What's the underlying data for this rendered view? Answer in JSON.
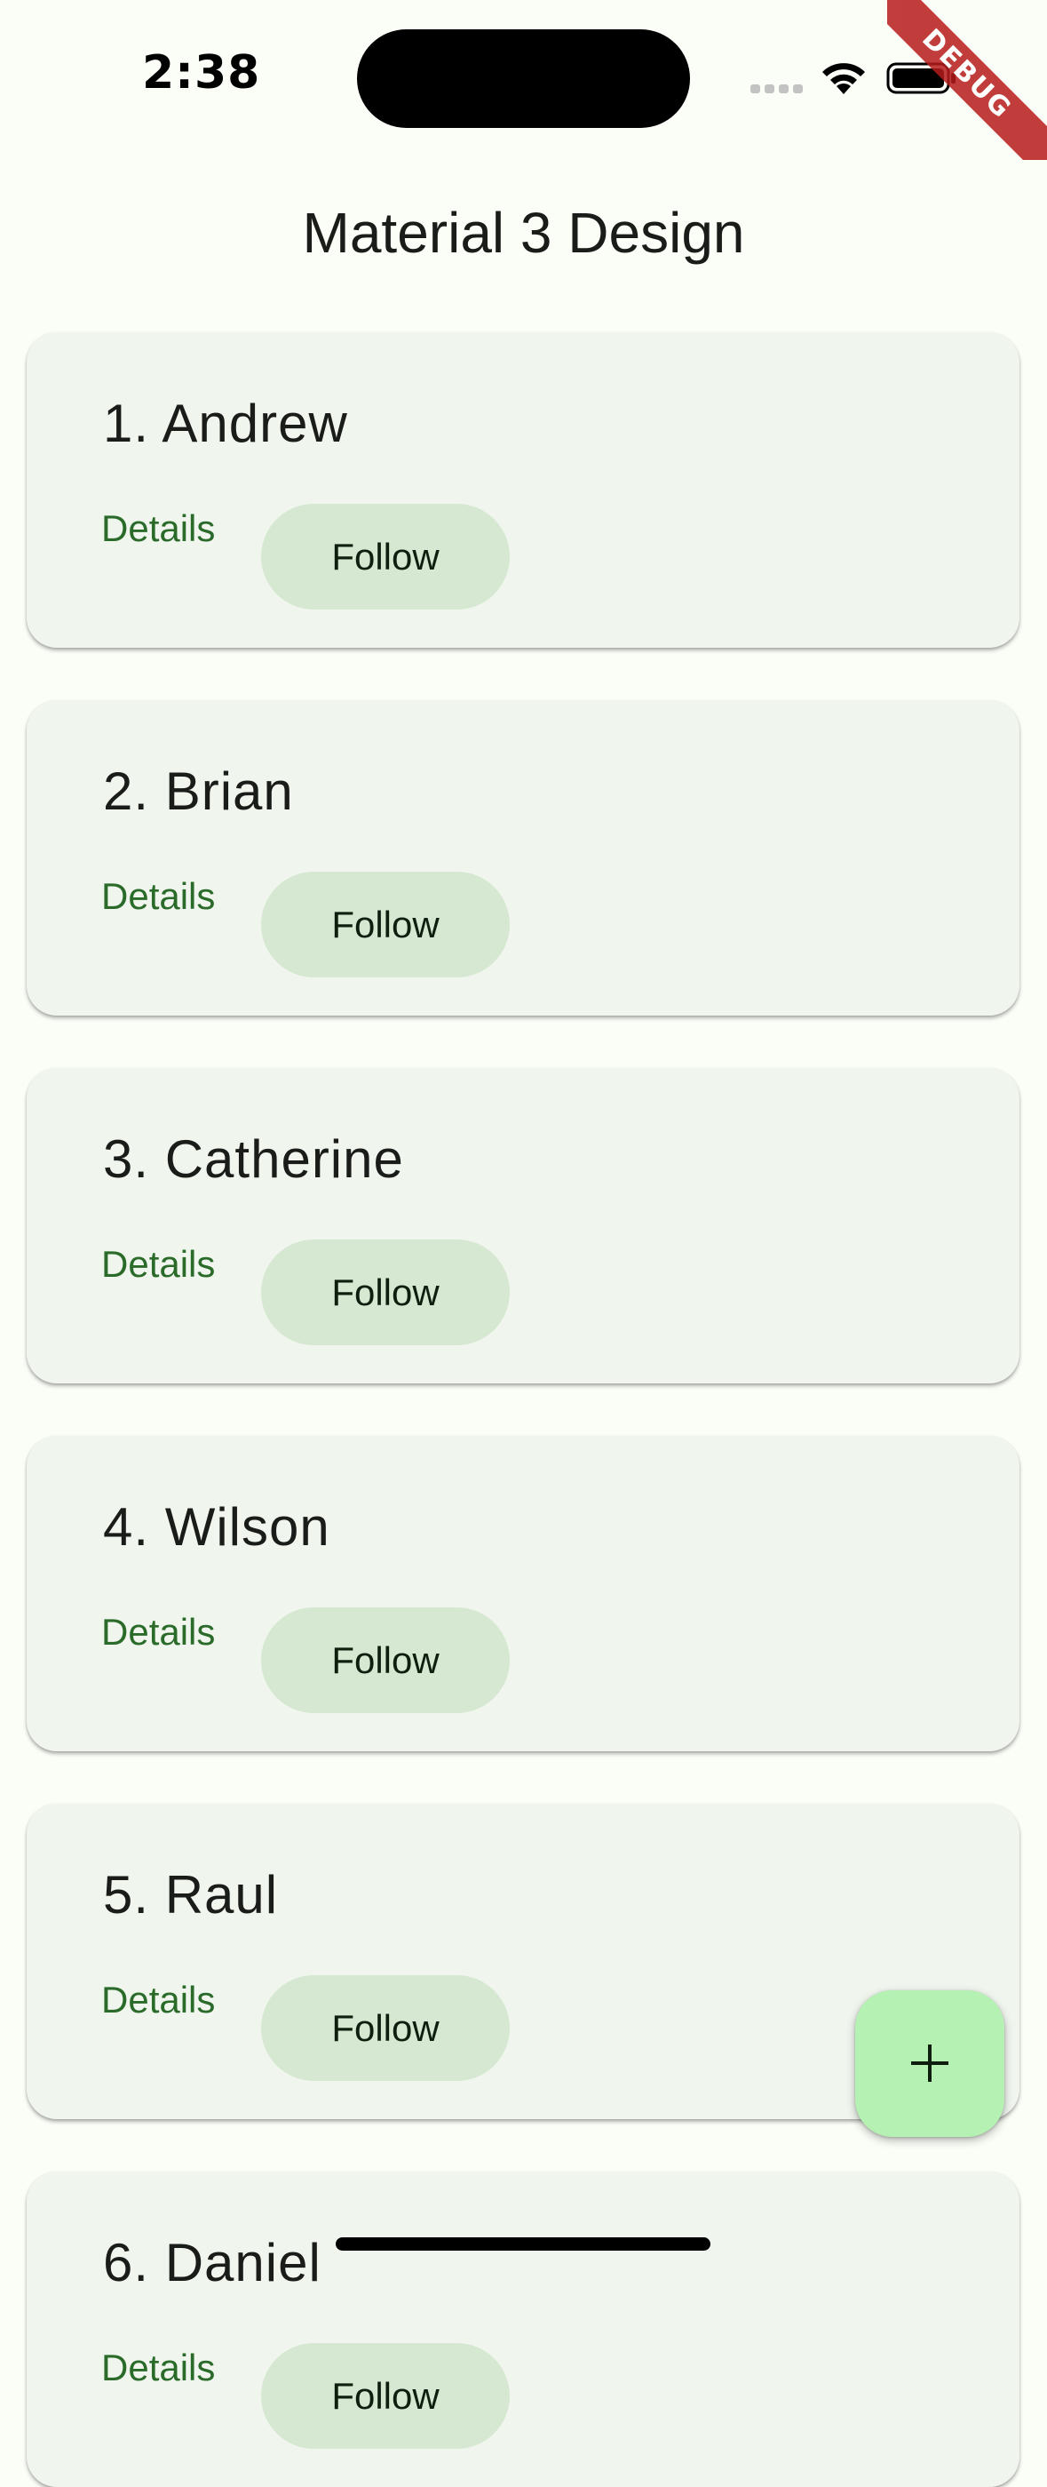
{
  "status_bar": {
    "time": "2:38"
  },
  "debug_banner": "DEBUG",
  "app_bar": {
    "title": "Material 3 Design"
  },
  "cards": [
    {
      "title": "1. Andrew",
      "details_label": "Details",
      "follow_label": "Follow"
    },
    {
      "title": "2. Brian",
      "details_label": "Details",
      "follow_label": "Follow"
    },
    {
      "title": "3. Catherine",
      "details_label": "Details",
      "follow_label": "Follow"
    },
    {
      "title": "4. Wilson",
      "details_label": "Details",
      "follow_label": "Follow"
    },
    {
      "title": "5. Raul",
      "details_label": "Details",
      "follow_label": "Follow"
    },
    {
      "title": "6. Daniel",
      "details_label": "Details",
      "follow_label": "Follow"
    }
  ],
  "fab": {
    "icon": "plus-icon"
  },
  "colors": {
    "background": "#FBFDF7",
    "card": "#F0F5EE",
    "primary_text": "#2A6B2A",
    "follow_button": "#D6E8D1",
    "fab": "#B5F1B3",
    "debug_banner": "#B71C1C"
  }
}
